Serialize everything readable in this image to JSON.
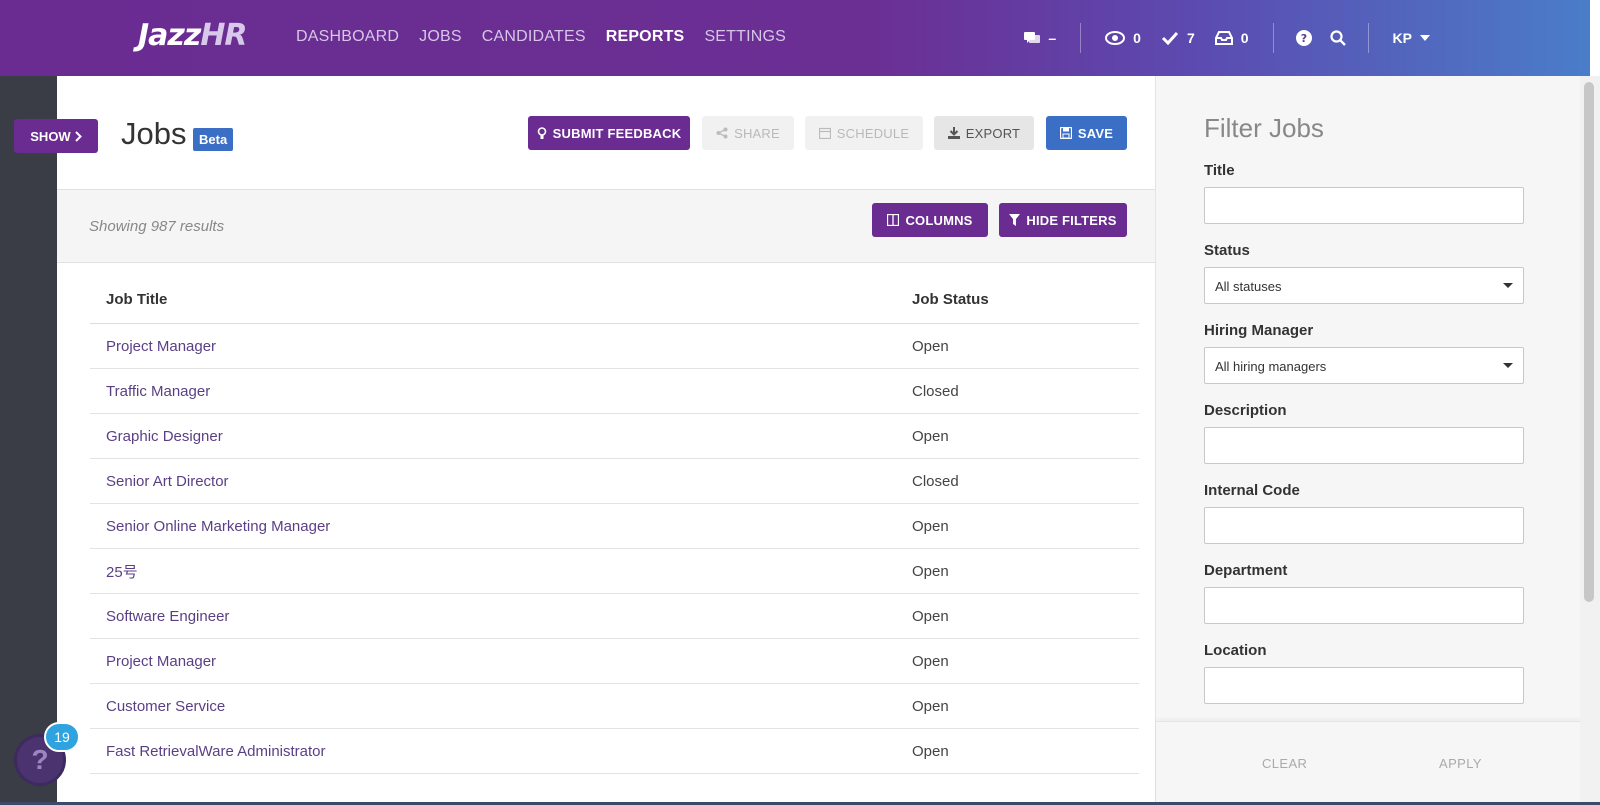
{
  "app": {
    "logo_main": "Jazz",
    "logo_suffix": "HR"
  },
  "nav": {
    "items": [
      "DASHBOARD",
      "JOBS",
      "CANDIDATES",
      "REPORTS",
      "SETTINGS"
    ],
    "active": "REPORTS"
  },
  "topbar": {
    "messages_value": "–",
    "views_count": "0",
    "tasks_count": "7",
    "inbox_count": "0",
    "user_initials": "KP"
  },
  "sidebar": {
    "show_label": "SHOW"
  },
  "page": {
    "title": "Jobs",
    "badge": "Beta",
    "buttons": {
      "feedback": "SUBMIT FEEDBACK",
      "share": "SHARE",
      "schedule": "SCHEDULE",
      "export": "EXPORT",
      "save": "SAVE"
    }
  },
  "toolbar": {
    "results": "Showing 987 results",
    "columns": "COLUMNS",
    "hide_filters": "HIDE FILTERS"
  },
  "table": {
    "headers": [
      "Job Title",
      "Job Status"
    ],
    "rows": [
      [
        "Project Manager",
        "Open"
      ],
      [
        "Traffic Manager",
        "Closed"
      ],
      [
        "Graphic Designer",
        "Open"
      ],
      [
        "Senior Art Director",
        "Closed"
      ],
      [
        "Senior Online Marketing Manager",
        "Open"
      ],
      [
        "25号",
        "Open"
      ],
      [
        "Software Engineer",
        "Open"
      ],
      [
        "Project Manager",
        "Open"
      ],
      [
        "Customer Service",
        "Open"
      ],
      [
        "Fast RetrievalWare Administrator",
        "Open"
      ]
    ]
  },
  "filter": {
    "title": "Filter Jobs",
    "labels": {
      "title": "Title",
      "status": "Status",
      "hiring_manager": "Hiring Manager",
      "description": "Description",
      "internal_code": "Internal Code",
      "department": "Department",
      "location": "Location"
    },
    "status_value": "All statuses",
    "hiring_manager_value": "All hiring managers",
    "clear": "CLEAR",
    "apply": "APPLY"
  },
  "help": {
    "badge_count": "19"
  },
  "colors": {
    "brand_purple": "#6a2c91",
    "accent_blue": "#3b6fc6",
    "link_purple": "#5b3f85"
  }
}
